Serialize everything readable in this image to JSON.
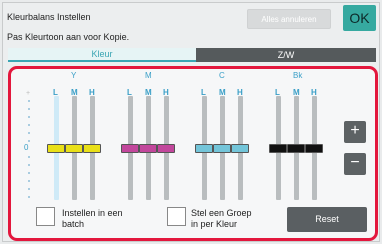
{
  "header": {
    "title": "Kleurbalans Instellen",
    "subtitle": "Pas Kleurtoon aan voor Kopie.",
    "cancel_label": "Alles annuleren",
    "ok_label": "OK"
  },
  "tabs": [
    {
      "label": "Kleur",
      "active": true
    },
    {
      "label": "Z/W",
      "active": false
    }
  ],
  "balance": {
    "zero_label": "0",
    "groups": [
      {
        "name": "Y",
        "color": "#e9e018",
        "sliders": [
          {
            "label": "L",
            "value": 0
          },
          {
            "label": "M",
            "value": 0
          },
          {
            "label": "H",
            "value": 0
          }
        ]
      },
      {
        "name": "M",
        "color": "#c2479c",
        "sliders": [
          {
            "label": "L",
            "value": 0
          },
          {
            "label": "M",
            "value": 0
          },
          {
            "label": "H",
            "value": 0
          }
        ]
      },
      {
        "name": "C",
        "color": "#73c5d9",
        "sliders": [
          {
            "label": "L",
            "value": 0
          },
          {
            "label": "M",
            "value": 0
          },
          {
            "label": "H",
            "value": 0
          }
        ]
      },
      {
        "name": "Bk",
        "color": "#111111",
        "sliders": [
          {
            "label": "L",
            "value": 0
          },
          {
            "label": "M",
            "value": 0
          },
          {
            "label": "H",
            "value": 0
          }
        ]
      }
    ],
    "plus_label": "+",
    "minus_label": "−"
  },
  "options": {
    "batch_label_line1": "Instellen in een",
    "batch_label_line2": "batch",
    "group_label_line1": "Stel een Groep",
    "group_label_line2": "in per Kleur",
    "batch_checked": false,
    "group_checked": false
  },
  "reset_label": "Reset"
}
